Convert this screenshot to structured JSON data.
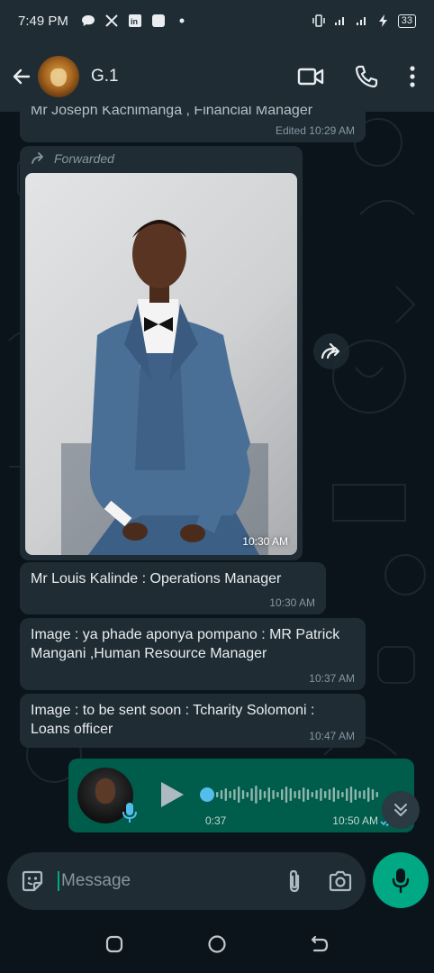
{
  "status_bar": {
    "time": "7:49 PM",
    "battery": "33"
  },
  "header": {
    "contact_name": "G.1",
    "back_icon": "arrow-left-icon",
    "video_icon": "video-camera-icon",
    "call_icon": "phone-icon",
    "menu_icon": "more-vertical-icon"
  },
  "messages": {
    "partial": {
      "text": "Mr Joseph Kachimanga , Financial Manager",
      "meta": "Edited 10:29 AM"
    },
    "photo": {
      "forwarded_label": "Forwarded",
      "time": "10:30 AM"
    },
    "msg1": {
      "text": "Mr Louis Kalinde : Operations Manager",
      "time": "10:30 AM"
    },
    "msg2": {
      "text": "Image : ya phade aponya pompano : MR Patrick Mangani ,Human Resource Manager",
      "time": "10:37 AM"
    },
    "msg3": {
      "text": "Image : to be sent soon : Tcharity Solomoni : Loans officer",
      "time": "10:47 AM"
    },
    "voice": {
      "duration": "0:37",
      "time": "10:50 AM",
      "progress": 0
    }
  },
  "composer": {
    "placeholder": "Message"
  },
  "colors": {
    "background": "#0b141a",
    "bubble_incoming": "#1f2c34",
    "bubble_outgoing": "#005c4b",
    "accent": "#00a884"
  }
}
